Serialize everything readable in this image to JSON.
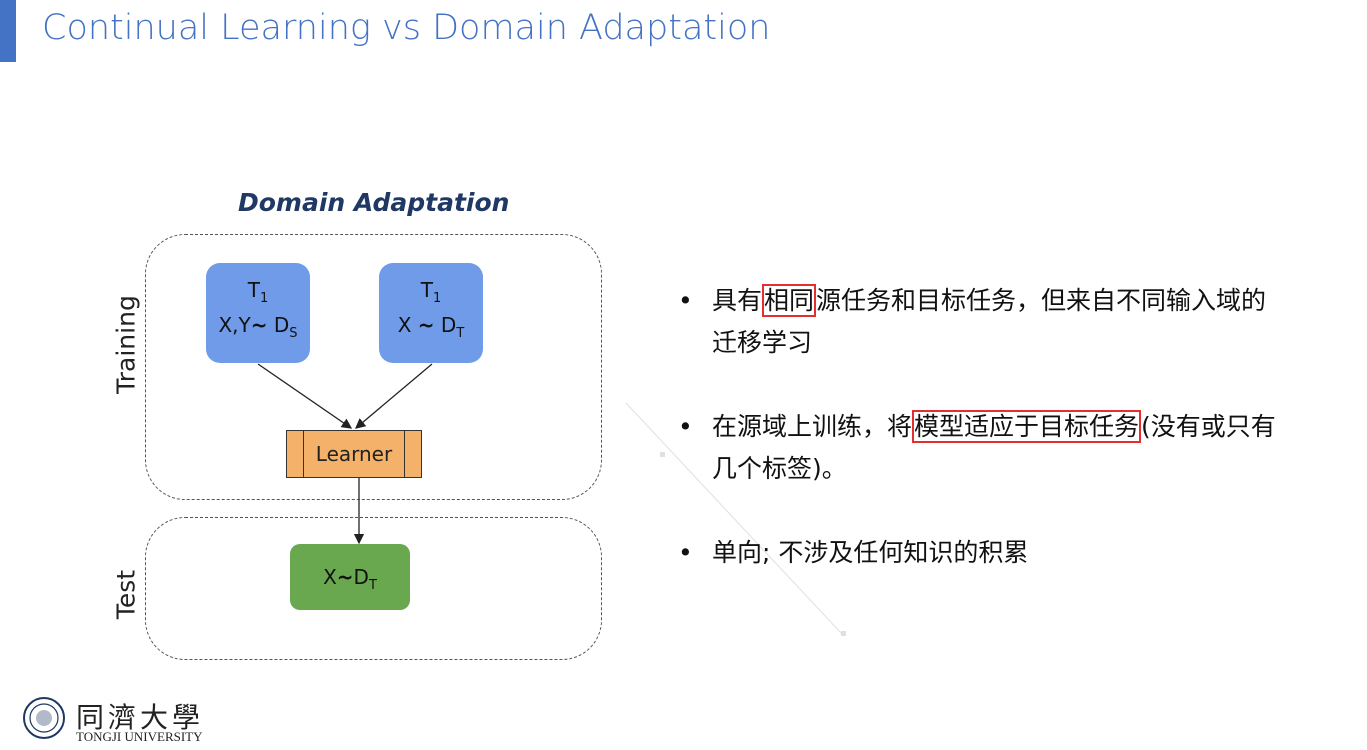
{
  "slide": {
    "title": "Continual Learning vs Domain Adaptation",
    "accent_color": "#4472c4"
  },
  "diagram": {
    "title": "Domain Adaptation",
    "training_label": "Training",
    "test_label": "Test",
    "task_left": {
      "t": "T",
      "t_sub": "1",
      "dist": "X,Y",
      "tilde": "~",
      "d": "D",
      "d_sub": "S"
    },
    "task_right": {
      "t": "T",
      "t_sub": "1",
      "dist": "X ",
      "tilde": "~",
      "d": "D",
      "d_sub": "T"
    },
    "learner_label": "Learner",
    "test_box": {
      "dist": "X",
      "tilde": "~",
      "d": "D",
      "d_sub": "T"
    }
  },
  "bullets": [
    {
      "marker": "•",
      "pre": "具有",
      "hl": "相同",
      "post": "源任务和目标任务，但来自不同输入域的迁移学习"
    },
    {
      "marker": "•",
      "pre": "在源域上训练，将",
      "hl": "模型适应于目标任务",
      "post": "(没有或只有几个标签)。"
    },
    {
      "marker": "•",
      "pre": "单向; 不涉及任何知识的积累",
      "hl": "",
      "post": ""
    }
  ],
  "logo": {
    "name_cn": "同濟大學",
    "name_en": "TONGJI UNIVERSITY"
  }
}
